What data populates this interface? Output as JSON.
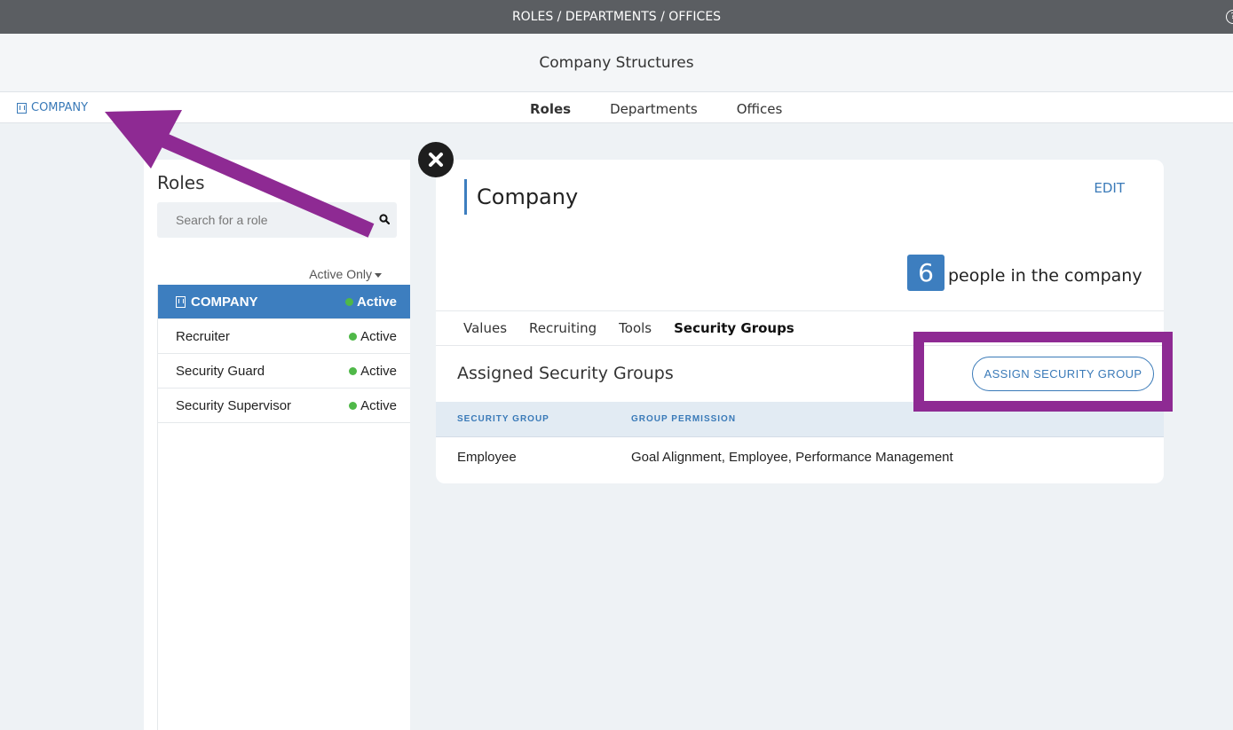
{
  "topbar": {
    "title": "ROLES / DEPARTMENTS / OFFICES",
    "help_icon": "?"
  },
  "header": {
    "title": "Company Structures"
  },
  "nav": {
    "company_link": "COMPANY",
    "tabs": [
      {
        "label": "Roles",
        "active": true
      },
      {
        "label": "Departments"
      },
      {
        "label": "Offices"
      }
    ]
  },
  "roles_panel": {
    "title": "Roles",
    "search_placeholder": "Search for a role",
    "filter_label": "Active Only",
    "items": [
      {
        "name": "COMPANY",
        "status": "Active",
        "selected": true,
        "icon": "building-icon"
      },
      {
        "name": "Recruiter",
        "status": "Active"
      },
      {
        "name": "Security Guard",
        "status": "Active"
      },
      {
        "name": "Security Supervisor",
        "status": "Active"
      }
    ]
  },
  "detail": {
    "title": "Company",
    "edit_label": "EDIT",
    "people_count": "6",
    "people_label": "people in the company",
    "tabs": [
      {
        "label": "Values"
      },
      {
        "label": "Recruiting"
      },
      {
        "label": "Tools"
      },
      {
        "label": "Security Groups",
        "active": true
      }
    ],
    "section_title": "Assigned Security Groups",
    "assign_button": "ASSIGN SECURITY GROUP",
    "table": {
      "headers": [
        "SECURITY GROUP",
        "GROUP PERMISSION"
      ],
      "rows": [
        {
          "group": "Employee",
          "permission": "Goal Alignment, Employee, Performance Management"
        }
      ]
    }
  },
  "colors": {
    "accent": "#3d7ebf",
    "annotation": "#8e2a93",
    "active_dot": "#4fb848",
    "topbar": "#5b5e62"
  }
}
